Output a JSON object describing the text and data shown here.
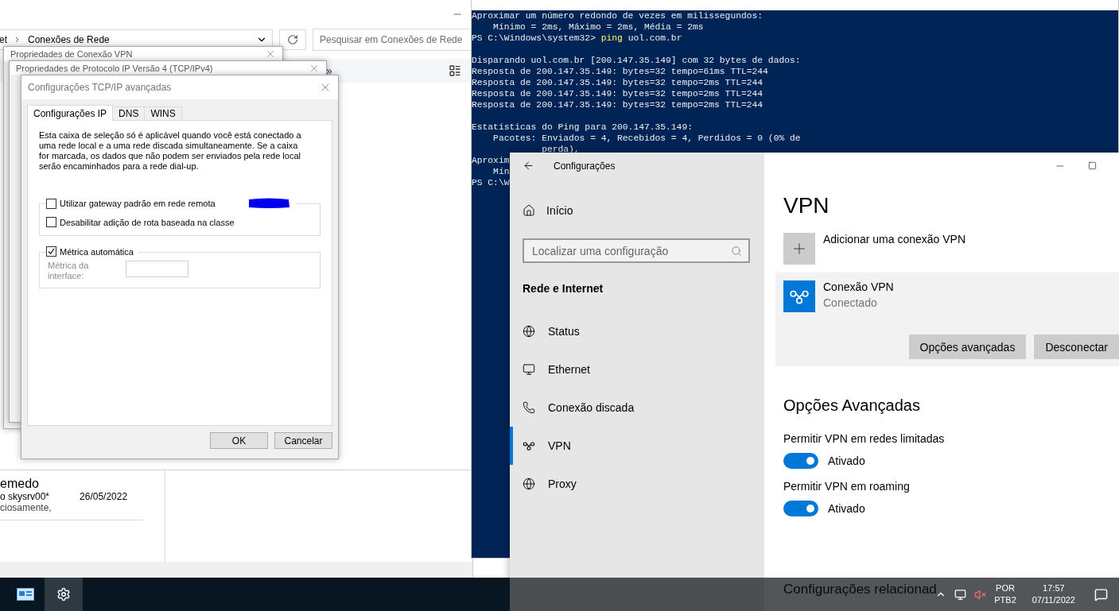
{
  "explorer": {
    "breadcrumb": [
      "et",
      "Conexões de Rede"
    ],
    "search": {
      "placeholder": "Pesquisar em Conexões de Rede"
    },
    "overflow": "»",
    "item": {
      "name": "emedo",
      "detail": "o skysrv00*",
      "date": "26/05/2022",
      "note": "ciosamente,"
    }
  },
  "back_dialogs": [
    {
      "title": "Propriedades de Conexão VPN"
    },
    {
      "title": "Propriedades de Protocolo IP Versão 4 (TCP/IPv4)"
    }
  ],
  "dialog": {
    "title": "Configurações TCP/IP avançadas",
    "tabs": [
      {
        "label": "Configurações IP",
        "selected": true
      },
      {
        "label": "DNS",
        "selected": false
      },
      {
        "label": "WINS",
        "selected": false
      }
    ],
    "description": "Esta caixa de seleção só é aplicável quando você está conectado a uma rede local e a uma rede discada simultaneamente. Se a caixa for marcada, os dados que não podem ser enviados pela rede local serão encaminhados para a rede dial-up.",
    "gateway": {
      "label": "Utilizar gateway padrão em rede remota",
      "checked": false
    },
    "class_route": {
      "label": "Desabilitar adição de rota baseada na classe",
      "checked": false
    },
    "auto_metric": {
      "label": "Métrica automática",
      "checked": true
    },
    "metric_field": {
      "label": "Métrica da interface:",
      "disabled": true
    },
    "buttons": [
      "OK",
      "Cancelar"
    ]
  },
  "console": {
    "lines": [
      {
        "kind": "output",
        "text": "Aproximar um número redondo de vezes em milissegundos:"
      },
      {
        "kind": "output",
        "text": "    Mínimo = 2ms, Máximo = 2ms, Média = 2ms"
      },
      {
        "kind": "command",
        "prompt": "PS C:\\Windows\\system32>",
        "command": "ping",
        "args": "uol.com.br"
      },
      {
        "kind": "blank"
      },
      {
        "kind": "output",
        "text": "Disparando uol.com.br [200.147.35.149] com 32 bytes de dados:"
      },
      {
        "kind": "output",
        "text": "Resposta de 200.147.35.149: bytes=32 tempo=61ms TTL=244"
      },
      {
        "kind": "output",
        "text": "Resposta de 200.147.35.149: bytes=32 tempo=2ms TTL=244"
      },
      {
        "kind": "output",
        "text": "Resposta de 200.147.35.149: bytes=32 tempo=2ms TTL=244"
      },
      {
        "kind": "output",
        "text": "Resposta de 200.147.35.149: bytes=32 tempo=2ms TTL=244"
      },
      {
        "kind": "blank"
      },
      {
        "kind": "output",
        "text": "Estatísticas do Ping para 200.147.35.149:"
      },
      {
        "kind": "output",
        "text": "    Pacotes: Enviados = 4, Recebidos = 4, Perdidos = 0 (0% de"
      },
      {
        "kind": "output",
        "text": "             perda),"
      },
      {
        "kind": "output",
        "text": "Aproxim"
      },
      {
        "kind": "output",
        "text": "    Mín"
      },
      {
        "kind": "output",
        "text": "PS C:\\W"
      }
    ]
  },
  "settings": {
    "title": "Configurações",
    "home": "Início",
    "search": {
      "placeholder": "Localizar uma configuração"
    },
    "section": "Rede e Internet",
    "nav": [
      {
        "label": "Status",
        "selected": false
      },
      {
        "label": "Ethernet",
        "selected": false
      },
      {
        "label": "Conexão discada",
        "selected": false
      },
      {
        "label": "VPN",
        "selected": true
      },
      {
        "label": "Proxy",
        "selected": false
      }
    ],
    "heading": "VPN",
    "add_label": "Adicionar uma conexão VPN",
    "connection": {
      "name": "Conexão VPN",
      "status": "Conectado",
      "buttons": [
        "Opções avançadas",
        "Desconectar"
      ]
    },
    "advanced_heading": "Opções Avançadas",
    "options": [
      {
        "label": "Permitir VPN em redes limitadas",
        "on": true,
        "state": "Ativado"
      },
      {
        "label": "Permitir VPN em roaming",
        "on": true,
        "state": "Ativado"
      }
    ],
    "related_heading": "Configurações relacionad"
  },
  "taskbar": {
    "apps": [
      {
        "selected": false
      },
      {
        "selected": true
      }
    ],
    "language": [
      "POR",
      "PTB2"
    ],
    "time": "17:57",
    "date": "07/11/2022"
  }
}
